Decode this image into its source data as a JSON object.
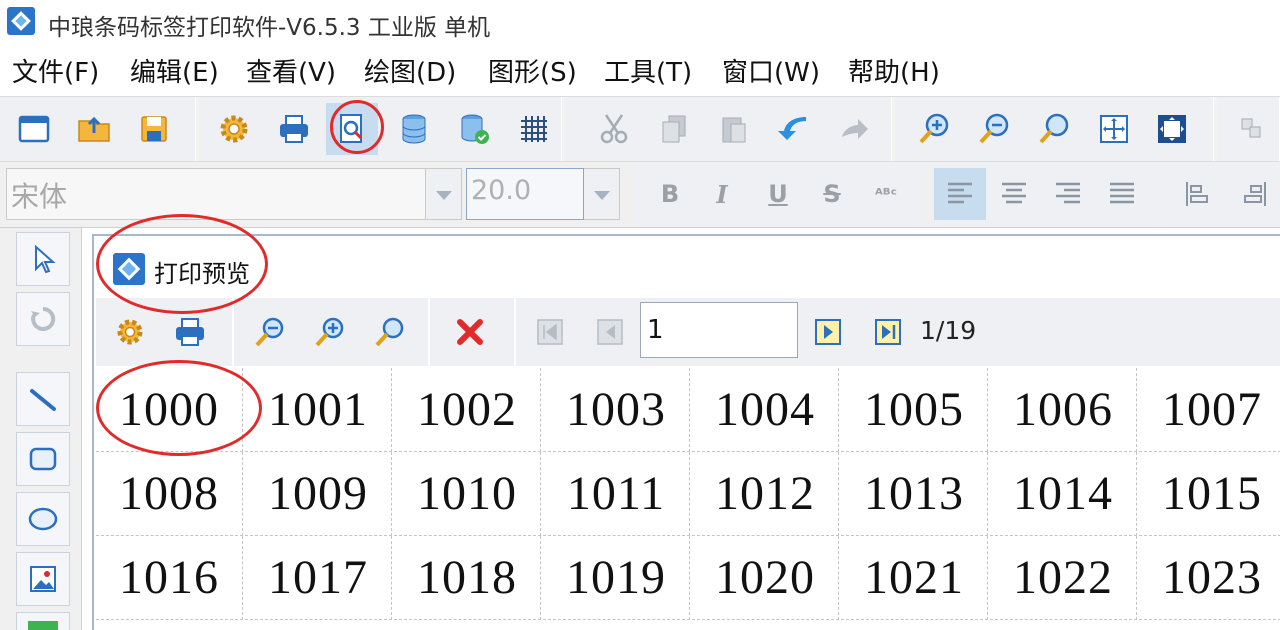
{
  "window": {
    "title": "中琅条码标签打印软件-V6.5.3 工业版 单机"
  },
  "menu": {
    "items": [
      "文件(F)",
      "编辑(E)",
      "查看(V)",
      "绘图(D)",
      "图形(S)",
      "工具(T)",
      "窗口(W)",
      "帮助(H)"
    ]
  },
  "toolbar": {
    "buttons": [
      "new-doc-icon",
      "open-folder-icon",
      "save-icon",
      "settings-gear-icon",
      "print-icon",
      "print-preview-icon",
      "database-icon",
      "database-connect-icon",
      "grid-icon",
      "cut-icon",
      "copy-icon",
      "paste-icon",
      "undo-icon",
      "redo-icon",
      "zoom-in-icon",
      "zoom-out-icon",
      "zoom-icon",
      "fit-page-icon",
      "fit-width-icon",
      "group-icon"
    ],
    "highlight": "print-preview-icon"
  },
  "format_bar": {
    "font_name": "宋体",
    "font_size": "20.0",
    "bold": "B",
    "italic": "I",
    "underline": "U",
    "strike": "S",
    "abc": "ᴬᴮᶜ"
  },
  "preview": {
    "title": "打印预览",
    "page_input": "1",
    "page_count": "1/19"
  },
  "labels": [
    "1000",
    "1001",
    "1002",
    "1003",
    "1004",
    "1005",
    "1006",
    "1007",
    "1008",
    "1009",
    "1010",
    "1011",
    "1012",
    "1013",
    "1014",
    "1015",
    "1016",
    "1017",
    "1018",
    "1019",
    "1020",
    "1021",
    "1022",
    "1023"
  ],
  "colors": {
    "accent_red": "#e02b2b",
    "toolbar_bg": "#eef0f3",
    "active_blue": "#c8dcf0"
  }
}
